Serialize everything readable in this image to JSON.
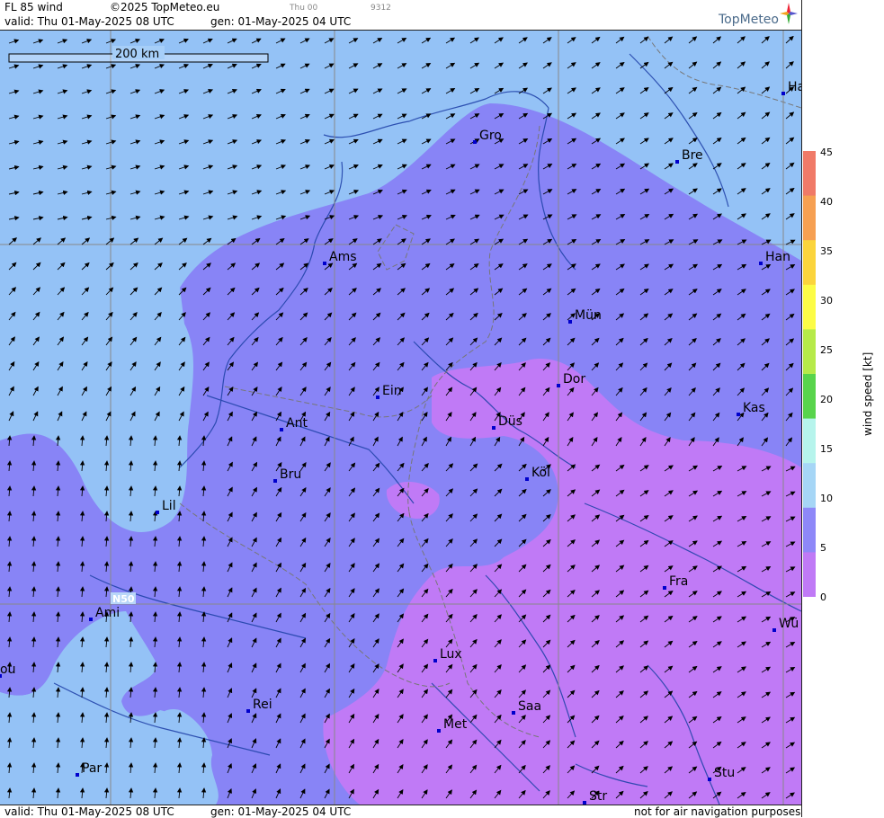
{
  "header": {
    "product": "FL 85 wind",
    "copyright": "©2025 TopMeteo.eu",
    "valid": "valid:  Thu  01-May-2025  08 UTC",
    "gen": "gen: 01-May-2025 04 UTC",
    "run_small": "Thu 00",
    "code_small": "9312",
    "brand": "TopMeteo"
  },
  "scale_bar": {
    "label": "200 km"
  },
  "grid_label": "N50",
  "footer": {
    "valid": "valid:  Thu  01-May-2025  08 UTC",
    "gen": "gen: 01-May-2025 04 UTC",
    "notice": "not for air navigation purposes"
  },
  "colorbar": {
    "title": "wind  speed  [kt]",
    "ticks": [
      "45",
      "40",
      "35",
      "30",
      "25",
      "20",
      "15",
      "10",
      "5",
      "0"
    ],
    "colors": [
      "#f07a68",
      "#f6a052",
      "#fbd43c",
      "#fcfc46",
      "#b6ea4a",
      "#58d44c",
      "#b6f4ec",
      "#a6d6f6",
      "#8e88f8",
      "#c07af6"
    ]
  },
  "legend_colors": {
    "light_blue_10_15kt": "#94c2f6",
    "blue_5_10kt": "#8884f6",
    "violet_0_5kt": "#c07af6"
  },
  "cities": [
    "Ha",
    "Gro",
    "Bre",
    "Ams",
    "Han",
    "Mün",
    "Ein",
    "Dor",
    "Düs",
    "Kas",
    "Ant",
    "Köl",
    "Bru",
    "Lil",
    "Fra",
    "Ami",
    "Wü",
    "Lux",
    "ou",
    "Rei",
    "Saa",
    "Met",
    "Stu",
    "Par",
    "Str"
  ]
}
